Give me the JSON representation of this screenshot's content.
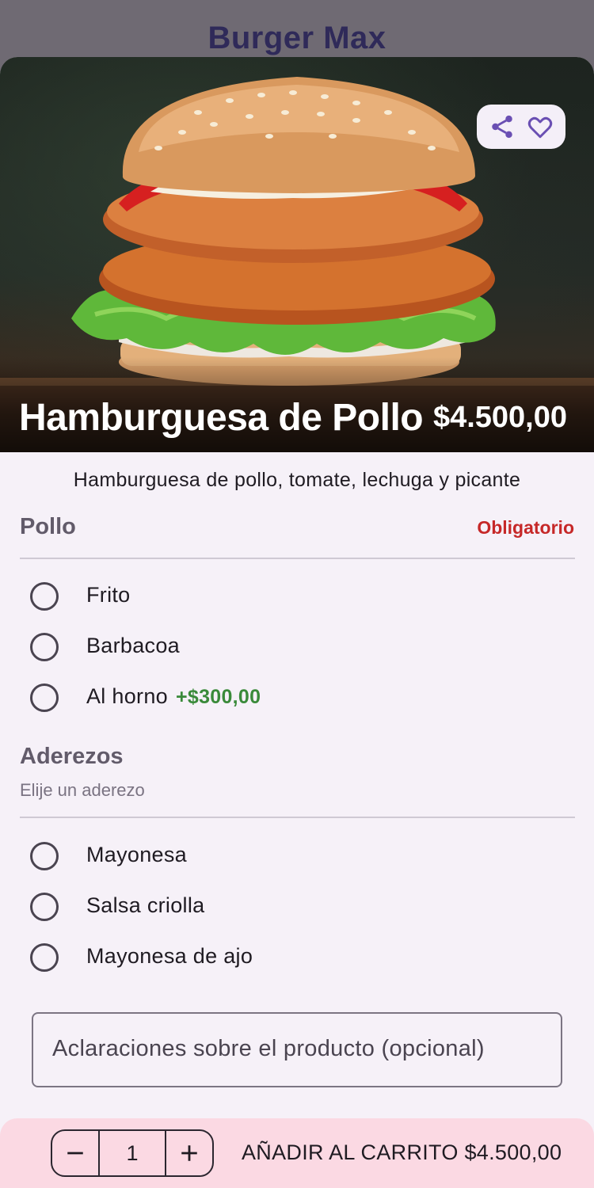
{
  "app": {
    "title": "Burger Max"
  },
  "product": {
    "name": "Hamburguesa de Pollo",
    "price": "$4.500,00",
    "description": "Hamburguesa de pollo, tomate, lechuga y picante"
  },
  "hero_actions": {
    "share_icon": "share-icon",
    "favorite_icon": "heart-outline-icon"
  },
  "groups": [
    {
      "title": "Pollo",
      "badge": "Obligatorio",
      "options": [
        {
          "label": "Frito",
          "extra": ""
        },
        {
          "label": "Barbacoa",
          "extra": ""
        },
        {
          "label": "Al horno",
          "extra": "+$300,00"
        }
      ]
    },
    {
      "title": "Aderezos",
      "subtitle": "Elije un aderezo",
      "options": [
        {
          "label": "Mayonesa"
        },
        {
          "label": "Salsa criolla"
        },
        {
          "label": "Mayonesa de ajo"
        }
      ]
    }
  ],
  "notes": {
    "placeholder": "Aclaraciones sobre el producto (opcional)"
  },
  "cart": {
    "quantity": "1",
    "add_label": "AÑADIR AL CARRITO $4.500,00"
  },
  "colors": {
    "accent": "#6a4fb3",
    "required": "#c62828",
    "extra_price": "#3a8a3a",
    "bottom_bar": "#fbd9e3"
  }
}
